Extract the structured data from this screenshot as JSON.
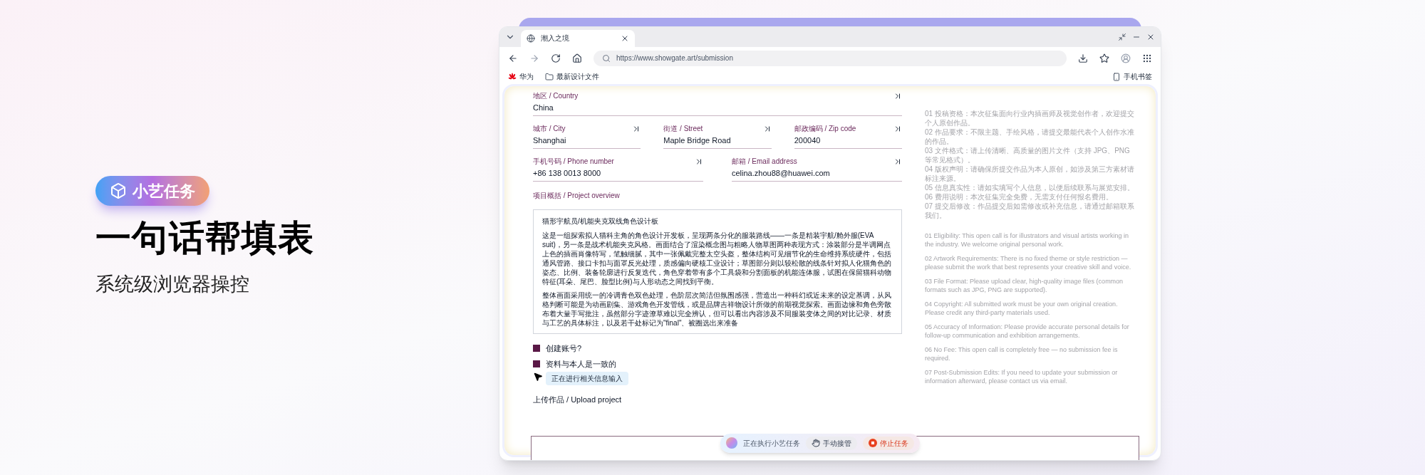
{
  "promo": {
    "badge": "小艺任务",
    "headline": "一句话帮填表",
    "subtitle": "系统级浏览器操控"
  },
  "browser": {
    "tabs": [
      {
        "title": "潮入之境",
        "selected": true
      }
    ],
    "url": "https://www.showgate.art/submission",
    "bookmarks": [
      {
        "label": "华为",
        "kind": "brand"
      },
      {
        "label": "最新设计文件",
        "kind": "folder"
      }
    ],
    "mobile_bookmarks": "手机书签"
  },
  "form": {
    "field_rows": [
      [
        {
          "label": "地区 / Country",
          "value": "China"
        }
      ],
      [
        {
          "label": "城市 / City",
          "value": "Shanghai"
        },
        {
          "label": "街道 / Street",
          "value": "Maple Bridge Road"
        },
        {
          "label": "邮政编码 / Zip code",
          "value": "200040"
        }
      ],
      [
        {
          "label": "手机号码 / Phone number",
          "value": "+86 138 0013 8000"
        },
        {
          "label": "邮箱 / Email address",
          "value": "celina.zhou88@huawei.com"
        }
      ]
    ],
    "overview": {
      "label": "项目概括 / Project overview",
      "title": "猫形宇航员/机能夹克双线角色设计板",
      "paragraphs": [
        "这是一组探索拟人猫科主角的角色设计开发板，呈现两条分化的服装路线——一条是精装宇航/舱外服(EVA suit)，另一条是战术机能夹克风格。画面结合了渲染概念图与粗略人物草图两种表现方式：涂装部分是半调网点上色的插画肖像特写，笔触细腻，其中一张佩戴完整太空头盔，整体结构可见细节化的生命维持系统硬件，包括通风管路、接口卡扣与面罩反光处理，质感偏向硬核工业设计；草图部分则以较松散的线条针对拟人化猫角色的姿态、比例、装备轮廓进行反复迭代，角色穿着带有多个工具袋和分割面板的机能连体服，试图在保留猫科动物特征(耳朵、尾巴、脸型比例)与人形动态之间找到平衡。",
        "整体画面采用统一的冷调青色双色处理，色阶层次简洁但氛围感强，营造出一种科幻或近未来的设定基调，从风格判断可能是为动画剧集、游戏角色开发管线，或是品牌吉祥物设计所做的前期视觉探索。画面边缘和角色旁散布着大量手写批注，虽然部分字迹潦草难以完全辨认，但可以看出内容涉及不同服装变体之间的对比记录、材质与工艺的具体标注，以及若干处标记为\"final\"、被圈选出来准备"
      ]
    },
    "checkboxes": [
      {
        "label": "创建账号?",
        "checked": true
      },
      {
        "label": "资料与本人是一致的",
        "checked": true
      }
    ],
    "tooltip": "正在进行相关信息输入",
    "upload_heading": "上传作品 / Upload project"
  },
  "notes": {
    "zh": [
      "01 投稿资格：本次征集面向行业内插画师及视觉创作者，欢迎提交个人原创作品。",
      "02 作品要求：不限主题、手绘风格，请提交最能代表个人创作水准的作品。",
      "03 文件格式：请上传清晰、高质量的图片文件（支持 JPG、PNG 等常见格式）。",
      "04 版权声明：请确保所提交作品为本人原创，如涉及第三方素材请标注来源。",
      "05 信息真实性：请如实填写个人信息，以便后续联系与展览安排。",
      "06 费用说明：本次征集完全免费，无需支付任何报名费用。",
      "07 提交后修改：作品提交后如需修改或补充信息，请通过邮箱联系我们。"
    ],
    "en": [
      "01 Eligibility: This open call is for illustrators and visual artists working in the industry. We welcome original personal work.",
      "02 Artwork Requirements: There is no fixed theme or style restriction — please submit the work that best represents your creative skill and voice.",
      "03 File Format: Please upload clear, high-quality image files (common formats such as JPG, PNG are supported).",
      "04 Copyright: All submitted work must be your own original creation. Please credit any third-party materials used.",
      "05 Accuracy of Information: Please provide accurate personal details for follow-up communication and exhibition arrangements.",
      "06 No Fee: This open call is completely free — no submission fee is required.",
      "07 Post-Submission Edits: If you need to update your submission or information afterward, please contact us via email."
    ]
  },
  "task_bar": {
    "status": "正在执行小艺任务",
    "takeover": "手动接管",
    "stop": "停止任务"
  }
}
